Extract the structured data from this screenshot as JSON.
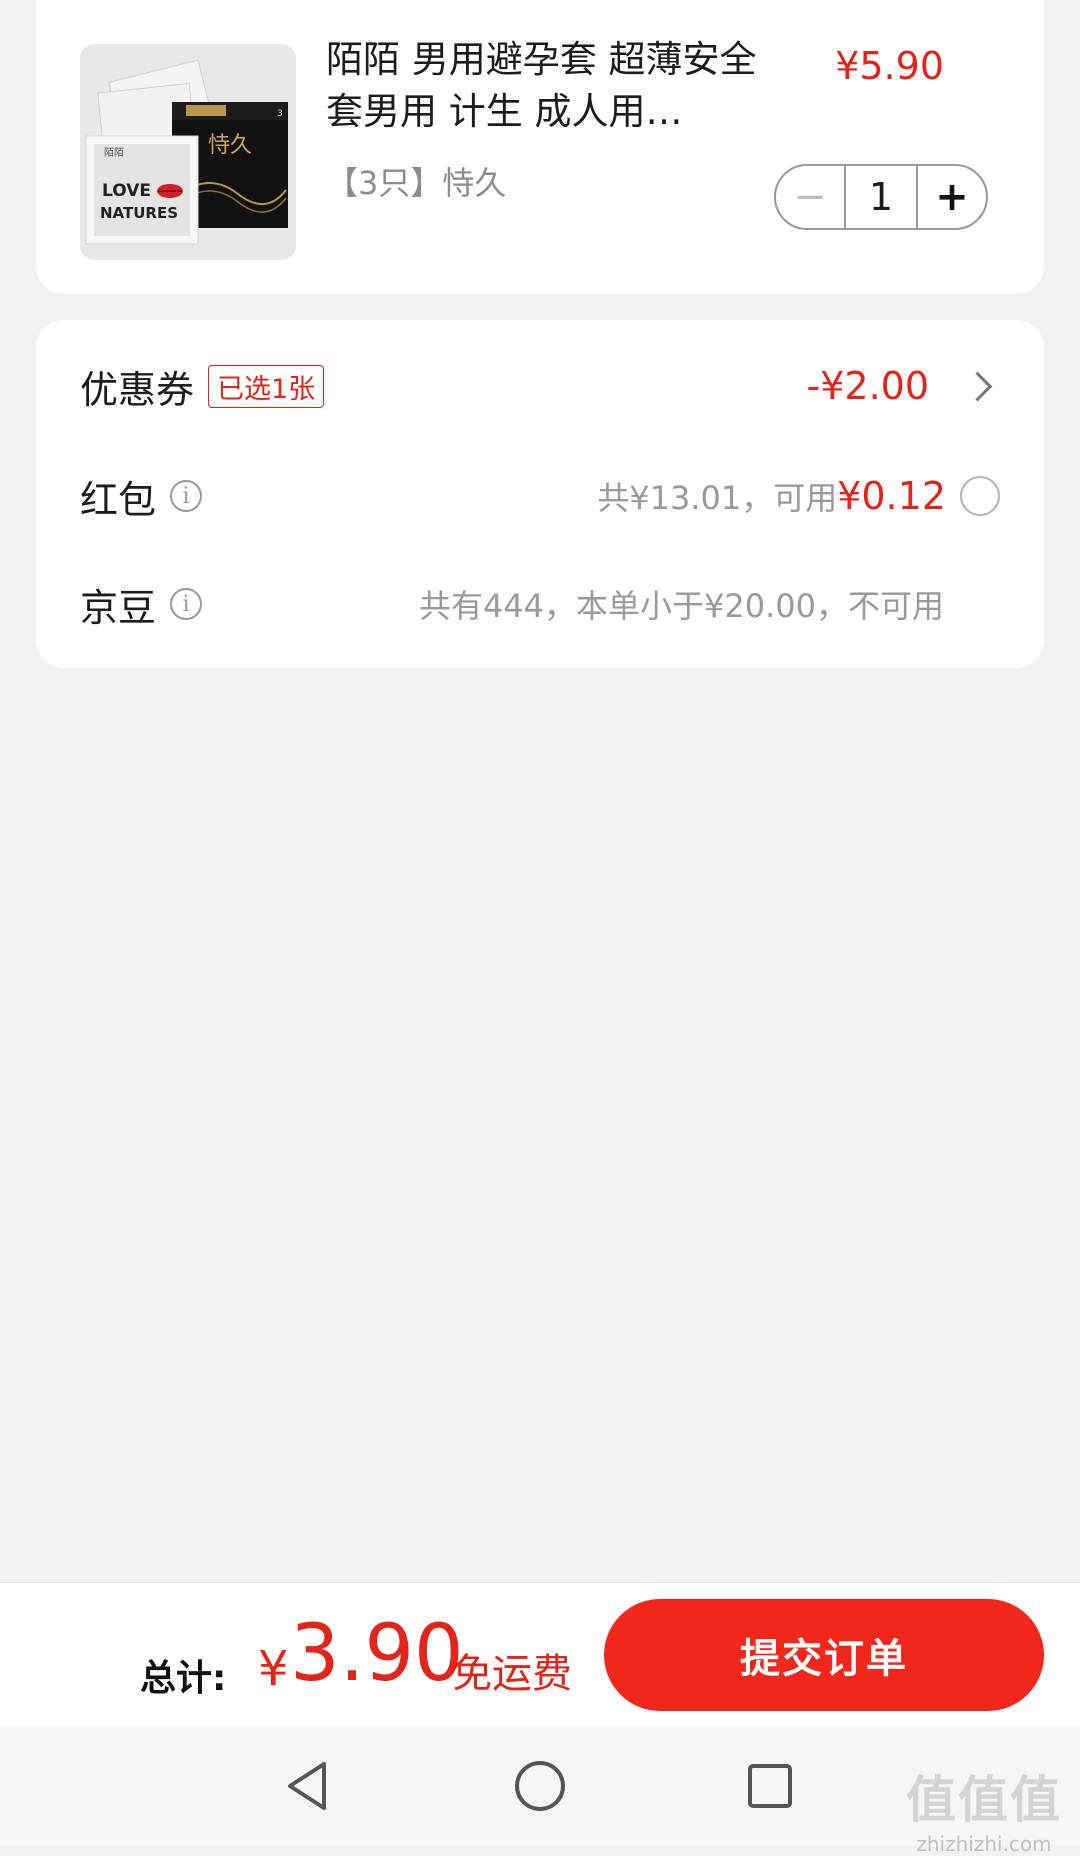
{
  "product": {
    "title": "陌陌 男用避孕套 超薄安全套男用 计生 成人用…",
    "price": "¥5.90",
    "spec": "【3只】恃久",
    "quantity": "1",
    "image_text": {
      "line1": "LOVE",
      "line2": "NATURES",
      "box_title": "恃久",
      "brand": "陌陌",
      "count": "3"
    }
  },
  "benefits": {
    "coupon": {
      "label": "优惠券",
      "badge": "已选1张",
      "value": "-¥2.00"
    },
    "red_packet": {
      "label": "红包",
      "note": "共¥13.01，可用",
      "value": "¥0.12"
    },
    "jingdou": {
      "label": "京豆",
      "note": "共有444，本单小于¥20.00，不可用"
    }
  },
  "checkout": {
    "total_label": "总计:",
    "currency": "¥",
    "amount": "3.90",
    "shipping": "免运费",
    "submit_label": "提交订单"
  },
  "watermark": {
    "main": "值值值",
    "sub": "zhizhizhi.com"
  },
  "colors": {
    "accent": "#e1251b",
    "button": "#f2271c",
    "background": "#f2f2f2"
  }
}
